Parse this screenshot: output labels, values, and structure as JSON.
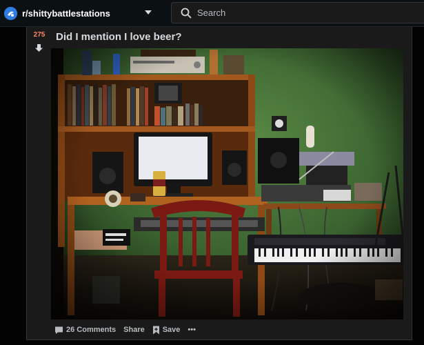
{
  "header": {
    "subreddit": "r/shittybattlestations",
    "search_placeholder": "Search",
    "accent": "#2f7de1"
  },
  "post": {
    "score": "275",
    "title": "Did I mention I love beer?",
    "image_alt": "Photo of a cluttered home desk setup with a monitor, shelves of records, speakers, a beer can, a red wooden chair and a keyboard synthesizer",
    "actions": {
      "comments": "26 Comments",
      "share": "Share",
      "save": "Save",
      "more": "•••"
    },
    "score_color": "#ff8b60"
  },
  "icons": [
    "subreddit-avatar-icon",
    "chevron-down-icon",
    "search-icon",
    "downvote-arrow-icon",
    "comment-icon",
    "bookmark-icon"
  ]
}
